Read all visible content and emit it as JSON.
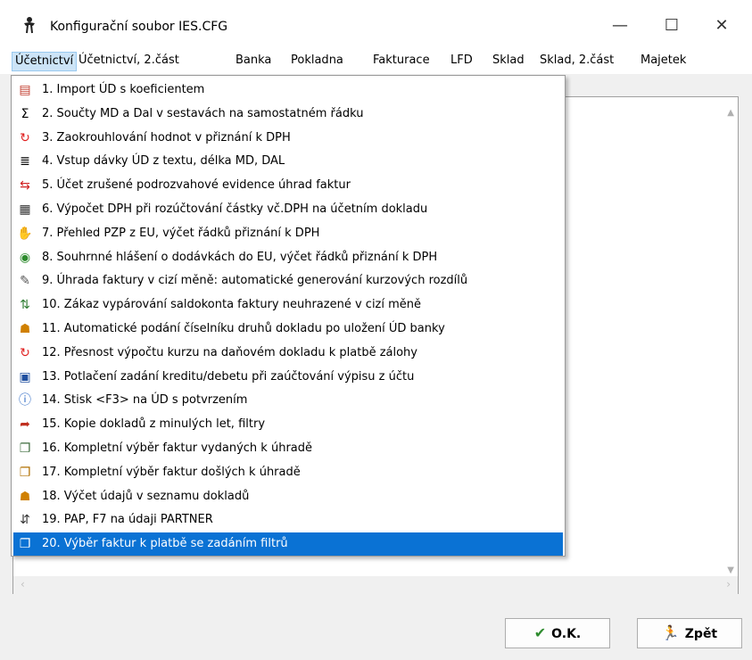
{
  "window": {
    "title": "Konfigurační soubor IES.CFG",
    "minimize_glyph": "—",
    "maximize_glyph": "☐",
    "close_glyph": "✕"
  },
  "menubar": {
    "items": [
      {
        "label": "Účetnictví"
      },
      {
        "label": "Účetnictví, 2.část"
      },
      {
        "label": "Banka"
      },
      {
        "label": "Pokladna"
      },
      {
        "label": "Fakturace"
      },
      {
        "label": "LFD"
      },
      {
        "label": "Sklad"
      },
      {
        "label": "Sklad, 2.část"
      },
      {
        "label": "Majetek"
      }
    ]
  },
  "dropdown": {
    "items": [
      {
        "label": "1. Import ÚD s koeficientem",
        "icon": "import-icon",
        "glyph": "▤",
        "color": "#c0392b"
      },
      {
        "label": "2. Součty MD a Dal v sestavách na samostatném řádku",
        "icon": "sigma-icon",
        "glyph": "Σ",
        "color": "#000000"
      },
      {
        "label": "3. Zaokrouhlování hodnot v přiznání k DPH",
        "icon": "refresh-icon",
        "glyph": "↻",
        "color": "#e02020"
      },
      {
        "label": "4. Vstup dávky ÚD z textu, délka MD, DAL",
        "icon": "text-lines-icon",
        "glyph": "≣",
        "color": "#000000"
      },
      {
        "label": "5. Účet zrušené podrozvahové evidence úhrad faktur",
        "icon": "arrows-icon",
        "glyph": "⇆",
        "color": "#d02020"
      },
      {
        "label": "6. Výpočet DPH při rozúčtování částky vč.DPH na účetním dokladu",
        "icon": "calculator-icon",
        "glyph": "▦",
        "color": "#333333"
      },
      {
        "label": "7. Přehled PZP z EU, výčet řádků přiznání k DPH",
        "icon": "handshake-icon",
        "glyph": "✋",
        "color": "#4a7bd0"
      },
      {
        "label": "8. Souhrnné hlášení o dodávkách do EU, výčet řádků přiznání k DPH",
        "icon": "target-icon",
        "glyph": "◉",
        "color": "#2e8b2e"
      },
      {
        "label": "9. Úhrada faktury v cizí měně: automatické generování kurzových rozdílů",
        "icon": "pen-icon",
        "glyph": "✎",
        "color": "#555555"
      },
      {
        "label": "10. Zákaz vypárování saldokonta faktury neuhrazené v cizí měně",
        "icon": "sort-icon",
        "glyph": "⇅",
        "color": "#2e7d32"
      },
      {
        "label": "11. Automatické podání číselníku druhů dokladu po uložení ÚD banky",
        "icon": "people-icon",
        "glyph": "☗",
        "color": "#d08000"
      },
      {
        "label": "12. Přesnost výpočtu kurzu na daňovém dokladu k platbě zálohy",
        "icon": "refresh-icon",
        "glyph": "↻",
        "color": "#e02020"
      },
      {
        "label": "13. Potlačení zadání kreditu/debetu při zaúčtování výpisu z účtu",
        "icon": "window-icon",
        "glyph": "▣",
        "color": "#2050a0"
      },
      {
        "label": "14. Stisk <F3> na ÚD s potvrzením",
        "icon": "info-icon",
        "glyph": "ⓘ",
        "color": "#2060c0"
      },
      {
        "label": "15. Kopie dokladů z minulých let, filtry",
        "icon": "copy-arrow-icon",
        "glyph": "➦",
        "color": "#c03020"
      },
      {
        "label": "16. Kompletní výběr faktur vydaných k úhradě",
        "icon": "documents-icon",
        "glyph": "❐",
        "color": "#3a6a3a"
      },
      {
        "label": "17. Kompletní výběr faktur došlých k úhradě",
        "icon": "documents-icon",
        "glyph": "❐",
        "color": "#b07000"
      },
      {
        "label": "18. Výčet údajů v seznamu dokladů",
        "icon": "people-icon",
        "glyph": "☗",
        "color": "#d08000"
      },
      {
        "label": "19. PAP, F7 na údaji PARTNER",
        "icon": "partner-icon",
        "glyph": "⇵",
        "color": "#333333"
      },
      {
        "label": "20. Výběr faktur k platbě se zadáním filtrů",
        "icon": "documents-icon",
        "glyph": "❐",
        "color": "#ffffff"
      }
    ],
    "selected_index": 19
  },
  "buttons": {
    "ok": {
      "label": "O.K.",
      "glyph": "✔",
      "color": "#2e8b2e"
    },
    "back": {
      "label": "Zpět",
      "glyph": "🏃",
      "color": "#2e8b2e"
    }
  },
  "colors": {
    "selection": "#0a72d4",
    "menu_active": "#cce4f7"
  }
}
